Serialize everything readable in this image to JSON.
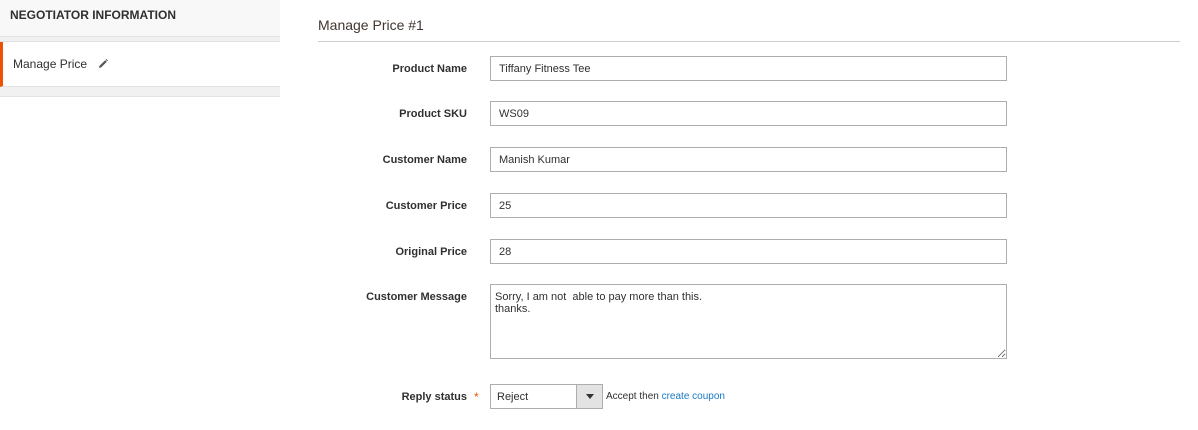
{
  "sidebar": {
    "heading": "NEGOTIATOR INFORMATION",
    "item_label": "Manage Price"
  },
  "main": {
    "title": "Manage Price #1",
    "fields": {
      "product_name": {
        "label": "Product Name",
        "value": "Tiffany Fitness Tee"
      },
      "product_sku": {
        "label": "Product SKU",
        "value": "WS09"
      },
      "customer_name": {
        "label": "Customer Name",
        "value": "Manish Kumar"
      },
      "customer_price": {
        "label": "Customer Price",
        "value": "25"
      },
      "original_price": {
        "label": "Original Price",
        "value": "28"
      },
      "customer_message": {
        "label": "Customer Message",
        "value": "Sorry, I am not  able to pay more than this.\nthanks."
      }
    },
    "reply": {
      "label": "Reply status",
      "required_mark": "*",
      "selected": "Reject",
      "note_prefix": "Accept then",
      "note_link": "create coupon"
    }
  },
  "colors": {
    "accent": "#eb5202",
    "link": "#1979c3"
  },
  "icons": {
    "edit": "pencil-icon",
    "dropdown": "chevron-down-icon"
  }
}
